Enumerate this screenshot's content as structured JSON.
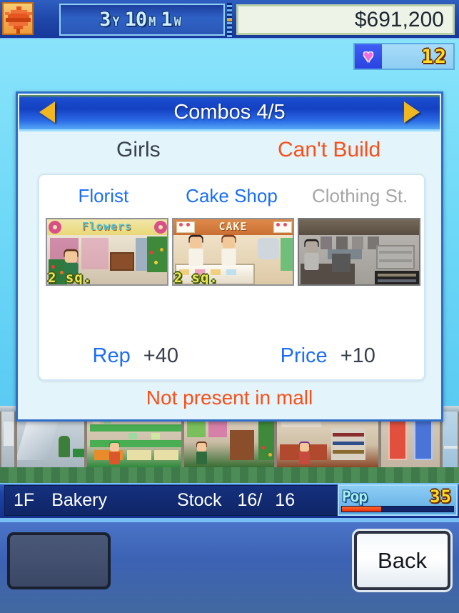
{
  "topbar": {
    "season_icon": "maple-leaf-icon",
    "date": {
      "year": "3",
      "year_unit": "Y",
      "month": "10",
      "month_unit": "M",
      "week": "1",
      "week_unit": "W"
    },
    "money": "$691,200"
  },
  "hearts": {
    "icon": "heart-icon",
    "count": "12"
  },
  "dialog": {
    "title": "Combos 4/5",
    "prev_arrow": "left-arrow-icon",
    "next_arrow": "right-arrow-icon",
    "category": "Girls",
    "status": "Can't Build",
    "shops": [
      {
        "name": "Florist",
        "present": true,
        "size": "2 sq.",
        "sign": "Flowers"
      },
      {
        "name": "Cake Shop",
        "present": true,
        "size": "2 sq.",
        "sign": "CAKE"
      },
      {
        "name": "Clothing St.",
        "present": false,
        "size": "",
        "sign": ""
      }
    ],
    "stats": [
      {
        "label": "Rep",
        "value": "+40"
      },
      {
        "label": "Price",
        "value": "+10"
      }
    ],
    "footer": "Not present in mall"
  },
  "statusbar": {
    "floor": "1F",
    "shop": "Bakery",
    "stock_label": "Stock",
    "stock_current": "16/",
    "stock_max": "16",
    "pop_label": "Pop",
    "pop_value": "35",
    "pop_percent": 35
  },
  "actionbar": {
    "back_label": "Back"
  },
  "colors": {
    "accent_blue": "#1b6ef5",
    "warning_orange": "#f8501a",
    "panel_border": "#2f6ec9",
    "disabled_gray": "#a6a6a6",
    "gold": "#f1b720",
    "pop_gauge": "#e8300c"
  }
}
